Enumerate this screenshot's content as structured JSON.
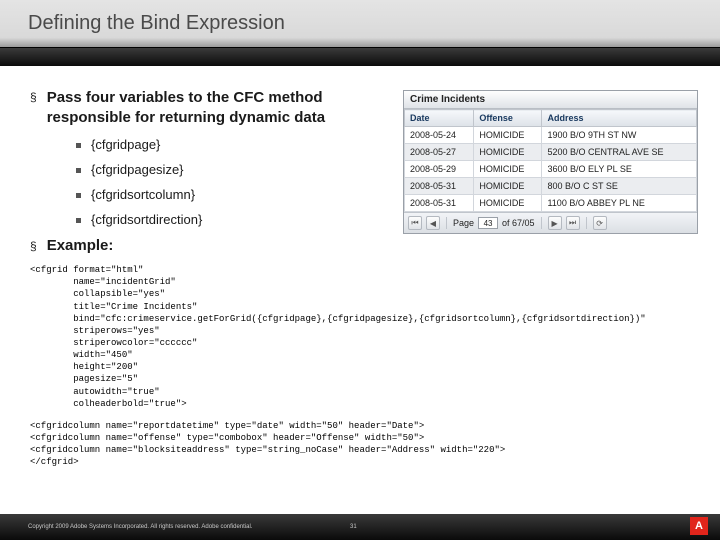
{
  "title": "Defining the Bind Expression",
  "main_bullet": "Pass four variables to the CFC method responsible for returning dynamic data",
  "sub_bullets": [
    "{cfgridpage}",
    "{cfgridpagesize}",
    "{cfgridsortcolumn}",
    "{cfgridsortdirection}"
  ],
  "example_label": "Example:",
  "code_block_1": "<cfgrid format=\"html\"\n        name=\"incidentGrid\"\n        collapsible=\"yes\"\n        title=\"Crime Incidents\"\n        bind=\"cfc:crimeservice.getForGrid({cfgridpage},{cfgridpagesize},{cfgridsortcolumn},{cfgridsortdirection})\"\n        striperows=\"yes\"\n        striperowcolor=\"cccccc\"\n        width=\"450\"\n        height=\"200\"\n        pagesize=\"5\"\n        autowidth=\"true\"\n        colheaderbold=\"true\">",
  "code_block_2": "<cfgridcolumn name=\"reportdatetime\" type=\"date\" width=\"50\" header=\"Date\">\n<cfgridcolumn name=\"offense\" type=\"combobox\" header=\"Offense\" width=\"50\">\n<cfgridcolumn name=\"blocksiteaddress\" type=\"string_noCase\" header=\"Address\" width=\"220\">\n</cfgrid>",
  "grid": {
    "title": "Crime Incidents",
    "headers": [
      "Date",
      "Offense",
      "Address"
    ],
    "rows": [
      [
        "2008-05-24",
        "HOMICIDE",
        "1900 B/O 9TH ST NW"
      ],
      [
        "2008-05-27",
        "HOMICIDE",
        "5200 B/O CENTRAL AVE SE"
      ],
      [
        "2008-05-29",
        "HOMICIDE",
        "3600 B/O ELY PL SE"
      ],
      [
        "2008-05-31",
        "HOMICIDE",
        "800 B/O C ST SE"
      ],
      [
        "2008-05-31",
        "HOMICIDE",
        "1100 B/O ABBEY PL NE"
      ]
    ],
    "pager": {
      "page_label": "Page",
      "page_value": "43",
      "of_label": "of 67/05"
    }
  },
  "footer": {
    "copyright": "Copyright 2009 Adobe Systems Incorporated.  All rights reserved.  Adobe confidential.",
    "page_number": "31",
    "logo_glyph": "A"
  }
}
